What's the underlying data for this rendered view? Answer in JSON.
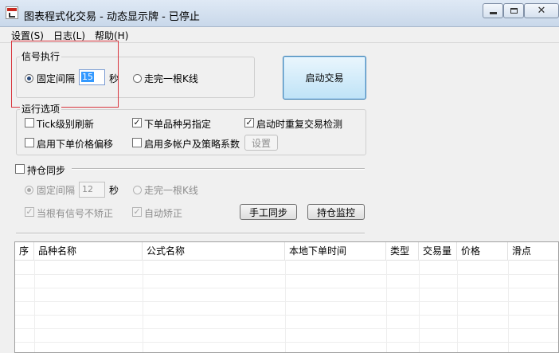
{
  "window": {
    "title": "图表程式化交易 - 动态显示牌 - 已停止",
    "app_icon": "app-chart-icon",
    "controls": [
      "minimize-icon",
      "maximize-icon",
      "close-icon"
    ]
  },
  "menu": {
    "items": [
      {
        "label": "设置(S)"
      },
      {
        "label": "日志(L)"
      },
      {
        "label": "帮助(H)"
      }
    ]
  },
  "signal": {
    "group_title": "信号执行",
    "fixed_interval_label": "固定间隔",
    "interval_value": "15",
    "seconds_label": "秒",
    "bar_close_label": "走完一根K线",
    "selected": "fixed_interval"
  },
  "start_button": {
    "label": "启动交易"
  },
  "run_options": {
    "group_title": "运行选项",
    "tick_refresh": {
      "label": "Tick级别刷新",
      "checked": false
    },
    "order_variety": {
      "label": "下单品种另指定",
      "checked": true
    },
    "restart_check": {
      "label": "启动时重复交易检测",
      "checked": true
    },
    "price_offset": {
      "label": "启用下单价格偏移",
      "checked": false
    },
    "multi_account": {
      "label": "启用多帐户及策略系数",
      "checked": false
    },
    "settings_button": "设置"
  },
  "position_sync": {
    "label": "持仓同步",
    "checked": false,
    "fixed_interval_label": "固定间隔",
    "interval_value": "12",
    "seconds_label": "秒",
    "bar_close_label": "走完一根K线",
    "no_correct_label": "当根有信号不矫正",
    "no_correct_checked": true,
    "auto_correct_label": "自动矫正",
    "auto_correct_checked": true,
    "manual_sync_button": "手工同步",
    "position_monitor_button": "持仓监控"
  },
  "table": {
    "columns": [
      "序",
      "品种名称",
      "公式名称",
      "本地下单时间",
      "类型",
      "交易量",
      "价格",
      "滑点"
    ],
    "rows": []
  },
  "colors": {
    "highlight_border": "#d9363e",
    "selection": "#3399ff",
    "primary_button": "#bfe3f7"
  }
}
